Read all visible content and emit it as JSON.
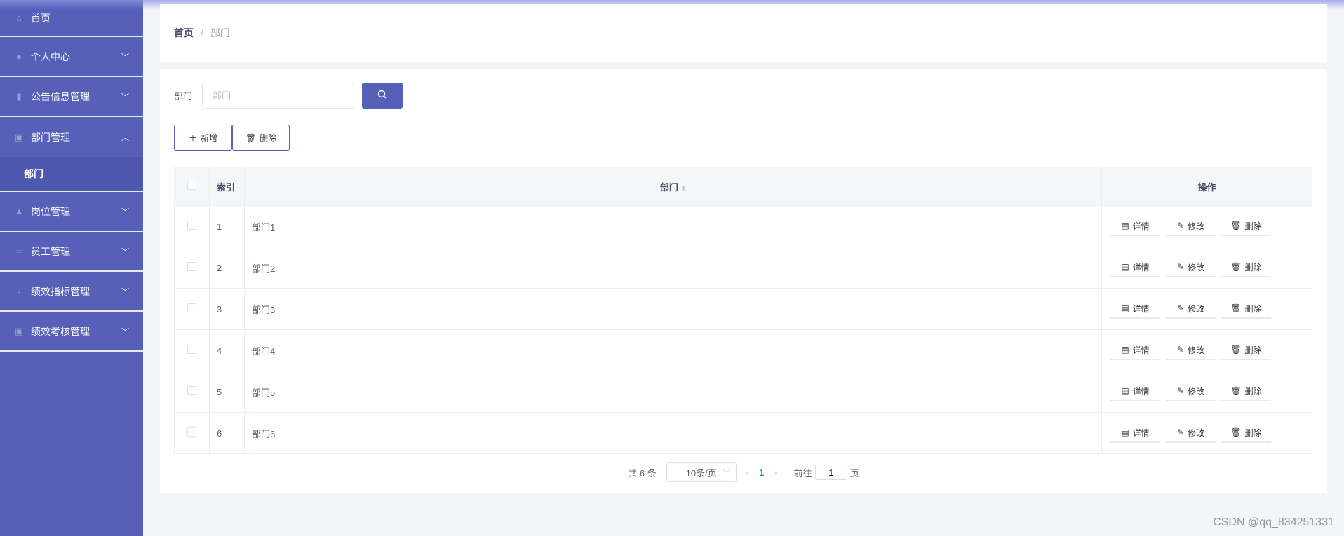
{
  "sidebar": {
    "items": [
      {
        "label": "首页",
        "icon": "home-icon"
      },
      {
        "label": "个人中心",
        "icon": "user-icon"
      },
      {
        "label": "公告信息管理",
        "icon": "microphone-icon"
      },
      {
        "label": "部门管理",
        "icon": "clipboard-icon",
        "sub": "部门"
      },
      {
        "label": "岗位管理",
        "icon": "stamp-icon"
      },
      {
        "label": "员工管理",
        "icon": "crop-icon"
      },
      {
        "label": "绩效指标管理",
        "icon": "mic-icon"
      },
      {
        "label": "绩效考核管理",
        "icon": "clipboard-check-icon"
      }
    ]
  },
  "breadcrumb": {
    "home": "首页",
    "sep": "/",
    "current": "部门"
  },
  "search": {
    "label": "部门",
    "placeholder": "部门"
  },
  "toolbar": {
    "add": "新增",
    "delete": "删除"
  },
  "table": {
    "headers": {
      "index": "索引",
      "dept": "部门",
      "ops": "操作"
    },
    "rows": [
      {
        "index": "1",
        "dept": "部门1"
      },
      {
        "index": "2",
        "dept": "部门2"
      },
      {
        "index": "3",
        "dept": "部门3"
      },
      {
        "index": "4",
        "dept": "部门4"
      },
      {
        "index": "5",
        "dept": "部门5"
      },
      {
        "index": "6",
        "dept": "部门6"
      }
    ],
    "actions": {
      "detail": "详情",
      "edit": "修改",
      "delete": "删除"
    }
  },
  "pagination": {
    "total": "共 6 条",
    "size": "10条/页",
    "current": "1",
    "goto": "前往",
    "goto_value": "1",
    "page_suffix": "页"
  },
  "watermark": "CSDN @qq_834251331"
}
